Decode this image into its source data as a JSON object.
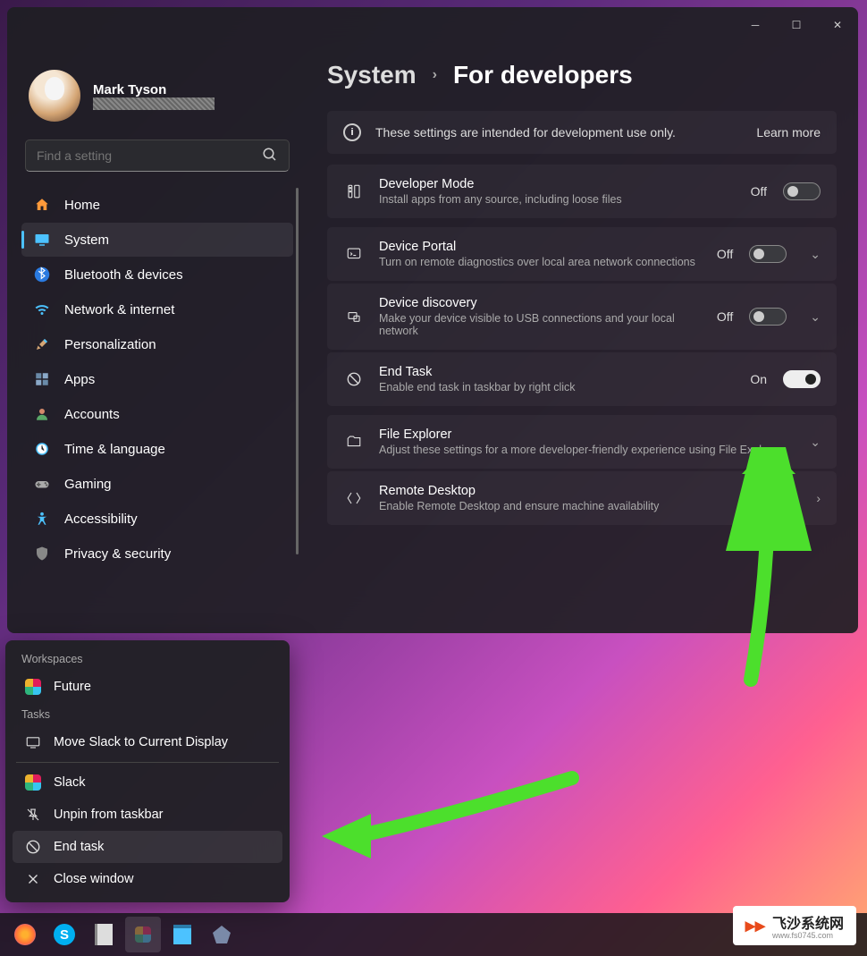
{
  "user": {
    "name": "Mark Tyson",
    "email": "████████████████"
  },
  "search": {
    "placeholder": "Find a setting"
  },
  "nav": [
    {
      "label": "Home",
      "icon": "home"
    },
    {
      "label": "System",
      "icon": "system",
      "selected": true
    },
    {
      "label": "Bluetooth & devices",
      "icon": "bluetooth"
    },
    {
      "label": "Network & internet",
      "icon": "wifi"
    },
    {
      "label": "Personalization",
      "icon": "brush"
    },
    {
      "label": "Apps",
      "icon": "apps"
    },
    {
      "label": "Accounts",
      "icon": "accounts"
    },
    {
      "label": "Time & language",
      "icon": "time"
    },
    {
      "label": "Gaming",
      "icon": "gaming"
    },
    {
      "label": "Accessibility",
      "icon": "access"
    },
    {
      "label": "Privacy & security",
      "icon": "privacy"
    }
  ],
  "breadcrumb": {
    "parent": "System",
    "current": "For developers"
  },
  "infoCard": {
    "msg": "These settings are intended for development use only.",
    "learn": "Learn more"
  },
  "settings": [
    {
      "title": "Developer Mode",
      "desc": "Install apps from any source, including loose files",
      "state": "Off",
      "on": false,
      "expand": false,
      "icon": "dev"
    },
    {
      "title": "Device Portal",
      "desc": "Turn on remote diagnostics over local area network connections",
      "state": "Off",
      "on": false,
      "expand": true,
      "icon": "portal"
    },
    {
      "title": "Device discovery",
      "desc": "Make your device visible to USB connections and your local network",
      "state": "Off",
      "on": false,
      "expand": true,
      "icon": "discovery"
    },
    {
      "title": "End Task",
      "desc": "Enable end task in taskbar by right click",
      "state": "On",
      "on": true,
      "expand": false,
      "icon": "endtask"
    },
    {
      "title": "File Explorer",
      "desc": "Adjust these settings for a more developer-friendly experience using File Explorer",
      "state": null,
      "on": null,
      "expand": true,
      "icon": "explorer"
    },
    {
      "title": "Remote Desktop",
      "desc": "Enable Remote Desktop and ensure machine availability",
      "state": null,
      "on": null,
      "expand": "right",
      "icon": "remote"
    }
  ],
  "contextMenu": {
    "workspacesLabel": "Workspaces",
    "workspace": {
      "label": "Future"
    },
    "tasksLabel": "Tasks",
    "tasks": [
      {
        "label": "Move Slack to Current Display",
        "icon": "display"
      },
      {
        "label": "Slack",
        "icon": "slack"
      },
      {
        "label": "Unpin from taskbar",
        "icon": "unpin"
      },
      {
        "label": "End task",
        "icon": "endtask",
        "hover": true
      },
      {
        "label": "Close window",
        "icon": "close"
      }
    ]
  },
  "watermark": {
    "brand": "飞沙系统网",
    "url": "www.fs0745.com"
  }
}
